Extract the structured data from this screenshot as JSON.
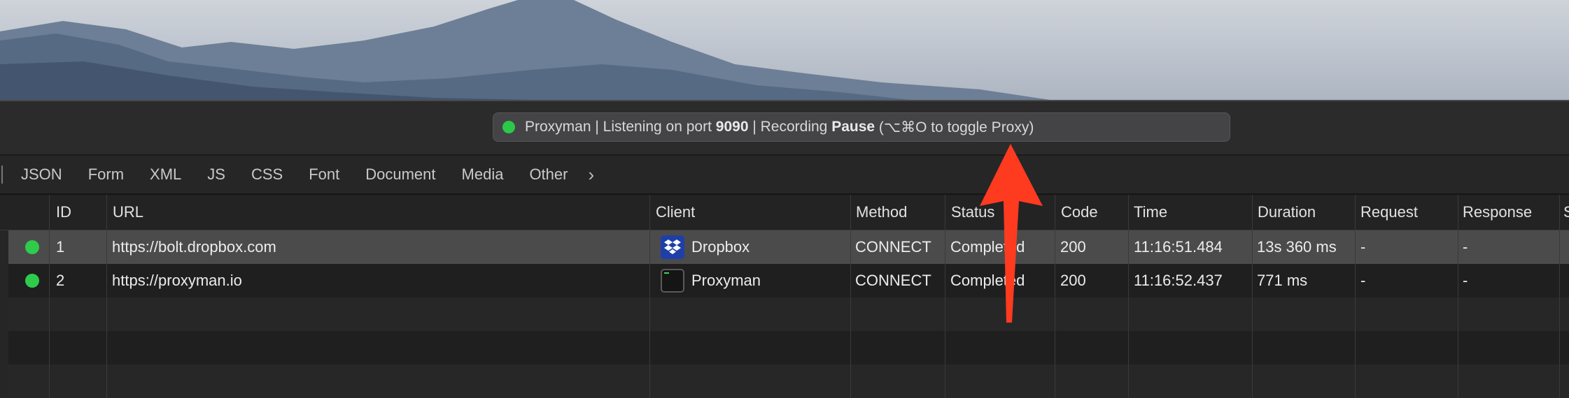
{
  "status": {
    "prefix": "Proxyman | Listening on port ",
    "port": "9090",
    "middle": " | Recording ",
    "mode": "Pause",
    "suffix": " (⌥⌘O to toggle Proxy)"
  },
  "filters": [
    "JSON",
    "Form",
    "XML",
    "JS",
    "CSS",
    "Font",
    "Document",
    "Media",
    "Other"
  ],
  "columns": [
    "ID",
    "URL",
    "Client",
    "Method",
    "Status",
    "Code",
    "Time",
    "Duration",
    "Request",
    "Response",
    "S"
  ],
  "rows": [
    {
      "id": "1",
      "url": "https://bolt.dropbox.com",
      "client": "Dropbox",
      "method": "CONNECT",
      "status": "Completed",
      "code": "200",
      "time": "11:16:51.484",
      "duration": "13s 360 ms",
      "request": "-",
      "response": "-"
    },
    {
      "id": "2",
      "url": "https://proxyman.io",
      "client": "Proxyman",
      "method": "CONNECT",
      "status": "Completed",
      "code": "200",
      "time": "11:16:52.437",
      "duration": "771 ms",
      "request": "-",
      "response": "-"
    }
  ],
  "colors": {
    "accent_green": "#2dc84a",
    "annotation_arrow": "#ff3b1f",
    "dropbox_blue": "#1f3fa8"
  }
}
